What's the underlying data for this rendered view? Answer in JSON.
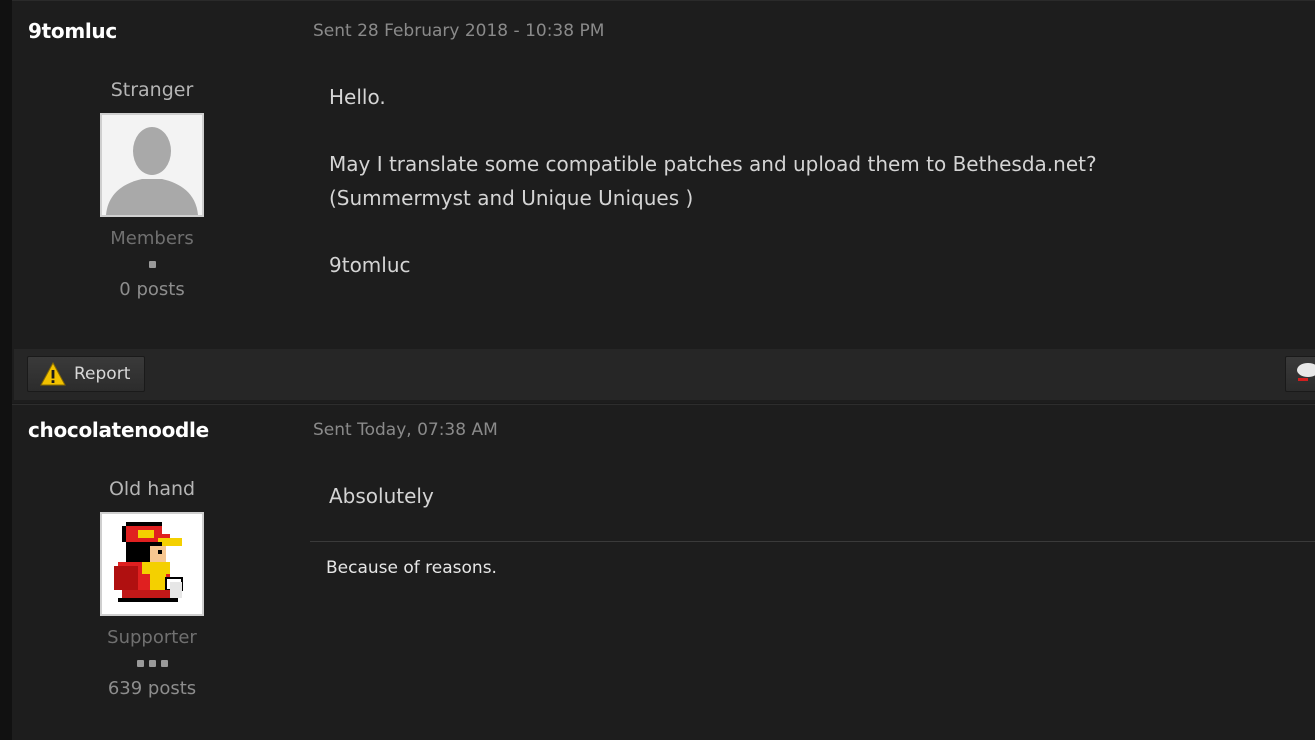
{
  "posts": [
    {
      "author": "9tomluc",
      "date": "Sent 28 February 2018 - 10:38 PM",
      "rank_title": "Stranger",
      "group": "Members",
      "post_count": "0 posts",
      "avatar_icon": "default-silhouette-icon",
      "body": [
        "Hello.",
        "May I translate some compatible patches and upload them to Bethesda.net?",
        "(Summermyst and Unique Uniques )",
        "9tomluc"
      ],
      "report_label": "Report"
    },
    {
      "author": "chocolatenoodle",
      "date": "Sent Today, 07:38 AM",
      "rank_title": "Old hand",
      "group": "Supporter",
      "post_count": "639 posts",
      "avatar_icon": "pixel-trainer-avatar-icon",
      "body": [
        "Absolutely"
      ],
      "signature": "Because of reasons."
    }
  ],
  "colors": {
    "background": "#1d1d1d",
    "username": "#ffffff",
    "body_text": "#d4d4d4",
    "date_text": "#8a8a8a",
    "warning_yellow": "#f2c200"
  }
}
